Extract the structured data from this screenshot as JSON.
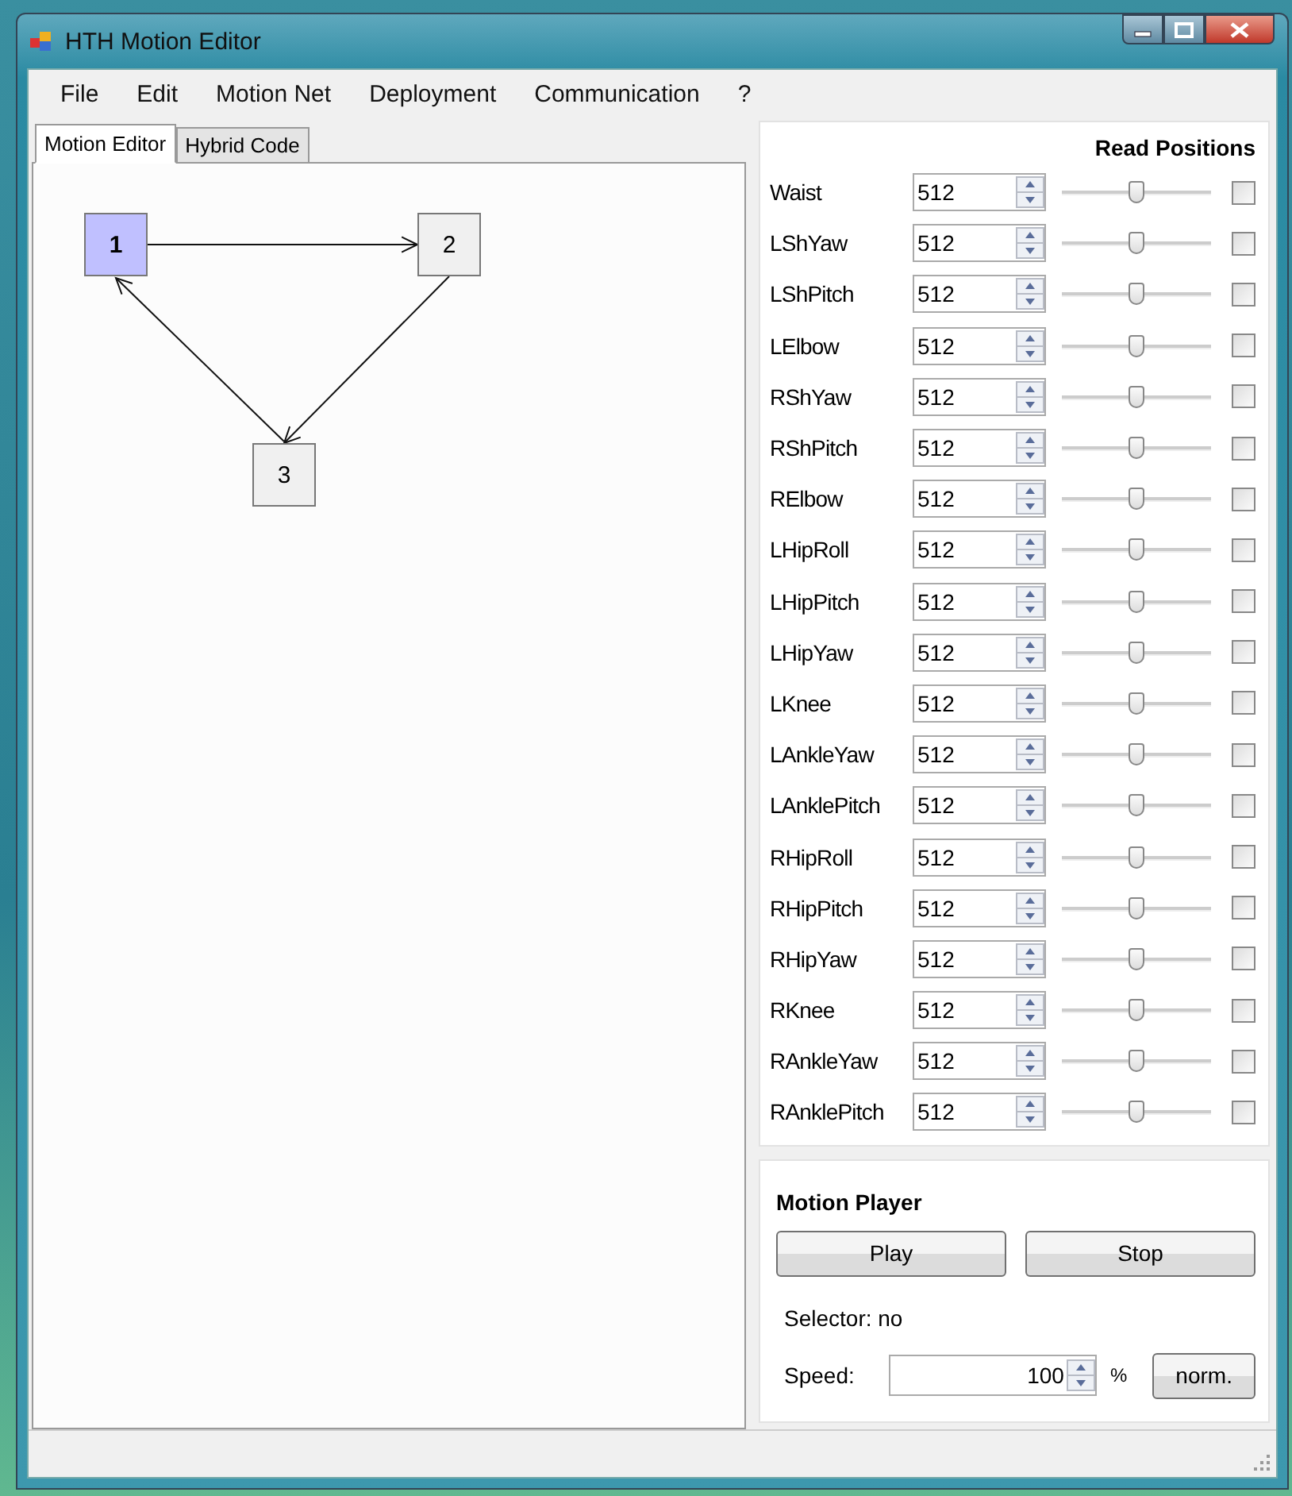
{
  "window": {
    "title": "HTH Motion Editor"
  },
  "menu": [
    "File",
    "Edit",
    "Motion Net",
    "Deployment",
    "Communication",
    "?"
  ],
  "tabs": [
    {
      "label": "Motion Editor",
      "selected": true
    },
    {
      "label": "Hybrid Code",
      "selected": false
    }
  ],
  "nodes": [
    {
      "label": "1",
      "selected": true
    },
    {
      "label": "2",
      "selected": false
    },
    {
      "label": "3",
      "selected": false
    }
  ],
  "read_positions": {
    "title": "Read Positions"
  },
  "joints": [
    {
      "name": "Waist",
      "value": "512",
      "level": 0.5,
      "checked": false
    },
    {
      "name": "LShYaw",
      "value": "512",
      "level": 0.5,
      "checked": false
    },
    {
      "name": "LShPitch",
      "value": "512",
      "level": 0.5,
      "checked": false
    },
    {
      "name": "LElbow",
      "value": "512",
      "level": 0.5,
      "checked": false
    },
    {
      "name": "RShYaw",
      "value": "512",
      "level": 0.5,
      "checked": false
    },
    {
      "name": "RShPitch",
      "value": "512",
      "level": 0.5,
      "checked": false
    },
    {
      "name": "RElbow",
      "value": "512",
      "level": 0.5,
      "checked": false
    },
    {
      "name": "LHipRoll",
      "value": "512",
      "level": 0.5,
      "checked": false
    },
    {
      "name": "LHipPitch",
      "value": "512",
      "level": 0.5,
      "checked": false
    },
    {
      "name": "LHipYaw",
      "value": "512",
      "level": 0.5,
      "checked": false
    },
    {
      "name": "LKnee",
      "value": "512",
      "level": 0.5,
      "checked": false
    },
    {
      "name": "LAnkleYaw",
      "value": "512",
      "level": 0.5,
      "checked": false
    },
    {
      "name": "LAnklePitch",
      "value": "512",
      "level": 0.5,
      "checked": false
    },
    {
      "name": "RHipRoll",
      "value": "512",
      "level": 0.5,
      "checked": false
    },
    {
      "name": "RHipPitch",
      "value": "512",
      "level": 0.5,
      "checked": false
    },
    {
      "name": "RHipYaw",
      "value": "512",
      "level": 0.5,
      "checked": false
    },
    {
      "name": "RKnee",
      "value": "512",
      "level": 0.5,
      "checked": false
    },
    {
      "name": "RAnkleYaw",
      "value": "512",
      "level": 0.5,
      "checked": false
    },
    {
      "name": "RAnklePitch",
      "value": "512",
      "level": 0.5,
      "checked": false
    }
  ],
  "motion_player": {
    "title": "Motion Player",
    "buttons": [
      "Play",
      "Stop"
    ],
    "selector": "Selector: no",
    "speed_label": "Speed:",
    "speed_value": "100",
    "speed_unit": "%",
    "norm_button": "norm."
  }
}
